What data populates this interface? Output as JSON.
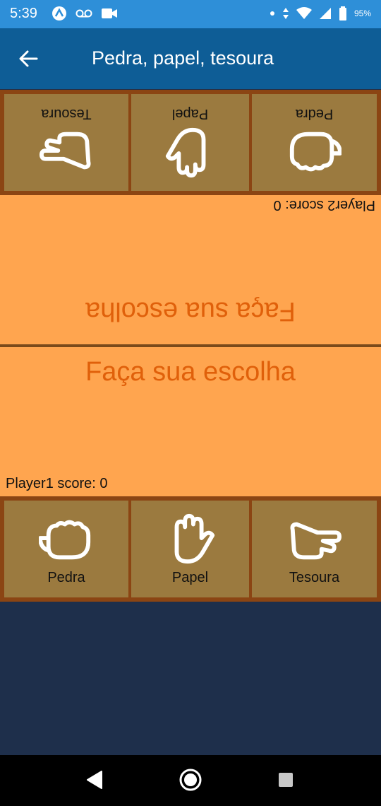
{
  "status_bar": {
    "time": "5:39",
    "battery": "95%"
  },
  "app_bar": {
    "title": "Pedra, papel, tesoura"
  },
  "player2": {
    "choices": [
      "Tesoura",
      "Papel",
      "Pedra"
    ],
    "score_text": "Player2 score: 0",
    "prompt": "Faça sua escolha"
  },
  "player1": {
    "choices": [
      "Pedra",
      "Papel",
      "Tesoura"
    ],
    "score_text": "Player1 score: 0",
    "prompt": "Faça sua escolha"
  },
  "colors": {
    "status_bar": "#2e8fd8",
    "app_bar": "#0e5d96",
    "panel_border": "#8b4513",
    "choice_cell": "#9b7a3f",
    "play_area": "#ffa54f",
    "prompt_text": "#e0600a",
    "bottom_fill": "#1e2f4b"
  },
  "icons": {
    "status_left": [
      "app-notification-icon",
      "voicemail-icon",
      "video-record-icon"
    ],
    "status_right": [
      "dot-icon",
      "data-arrows-icon",
      "wifi-icon",
      "signal-icon",
      "battery-icon"
    ],
    "choices": [
      "fist-icon",
      "open-hand-icon",
      "scissors-hand-icon"
    ],
    "nav": [
      "back-triangle-icon",
      "home-circle-icon",
      "recents-square-icon"
    ]
  }
}
